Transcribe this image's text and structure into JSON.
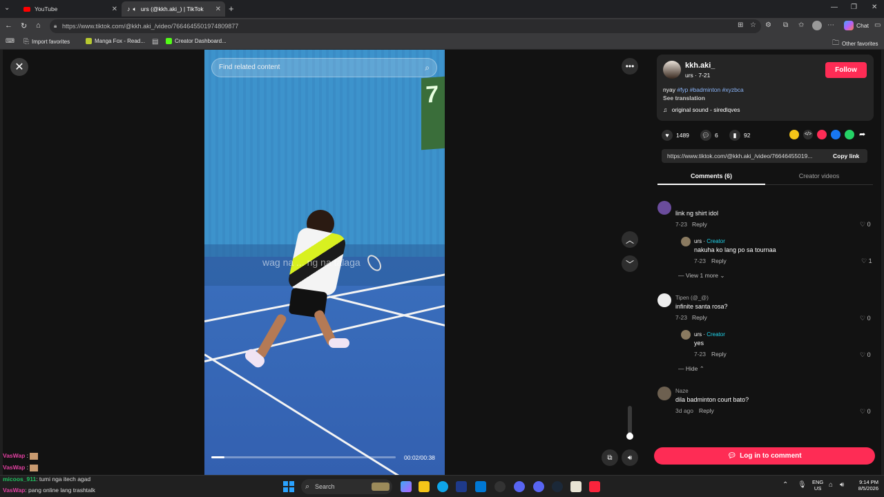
{
  "browser": {
    "tabs": [
      {
        "label": "YouTube",
        "icon": "youtube-icon"
      },
      {
        "label": "urs (@kkh.aki_) | TikTok",
        "icon": "tiktok-icon"
      }
    ],
    "url": "https://www.tiktok.com/@kkh.aki_/video/7664645501974809877",
    "chat_label": "Chat",
    "bookmarks": [
      "Import favorites",
      "Manga Fox - Read...",
      "Creator Dashboard..."
    ],
    "other_favorites": "Other favorites"
  },
  "player": {
    "search_placeholder": "Find related content",
    "overlay_caption": "wag na ... ng na talaga",
    "time": "00:02/00:38",
    "progress": 0.07,
    "volume": 0.2
  },
  "post": {
    "username": "kkh.aki_",
    "subline": "urs · 7-21",
    "follow_label": "Follow",
    "caption_prefix": "nyay",
    "hashtags": [
      "#fyp",
      "#badminton",
      "#xyzbca"
    ],
    "see_translation": "See translation",
    "sound": "original sound - siredlqves",
    "likes": "1489",
    "comments": "6",
    "saves": "92",
    "link": "https://www.tiktok.com/@kkh.aki_/video/76646455019...",
    "copy_label": "Copy link",
    "tab_comments": "Comments (6)",
    "tab_creator": "Creator videos"
  },
  "comments": [
    {
      "user": "",
      "text": "link ng shirt idol",
      "date": "7-23",
      "reply": "Reply",
      "likes": "0"
    },
    {
      "user": "urs",
      "tag": "Creator",
      "text": "nakuha ko lang po sa tournaa",
      "date": "7-23",
      "reply": "Reply",
      "likes": "1"
    },
    {
      "user": "Tipen (@_@)",
      "text": "infinite santa rosa?",
      "date": "7-23",
      "reply": "Reply",
      "likes": "0"
    },
    {
      "user": "urs",
      "tag": "Creator",
      "text": "yes",
      "date": "7-23",
      "reply": "Reply",
      "likes": "0"
    },
    {
      "user": "Naze",
      "text": "dila badminton court bato?",
      "date": "3d ago",
      "reply": "Reply",
      "likes": "0"
    }
  ],
  "view_more": "View 1 more",
  "hide": "Hide",
  "login_label": "Log in to comment",
  "stream_chat": [
    {
      "user": "VasWap",
      "text": ":",
      "color": "#e040a0"
    },
    {
      "user": "VasWap",
      "text": ":",
      "color": "#e040a0"
    },
    {
      "user": "micoos_911",
      "text": ": tumi nga itech agad",
      "color": "#20c060"
    },
    {
      "user": "VasWap",
      "text": ": pang online lang trashtalk",
      "color": "#e040a0"
    }
  ],
  "taskbar": {
    "search": "Search",
    "lang_top": "ENG",
    "lang_bottom": "US",
    "time": "9:14 PM",
    "date": "8/5/2026"
  }
}
